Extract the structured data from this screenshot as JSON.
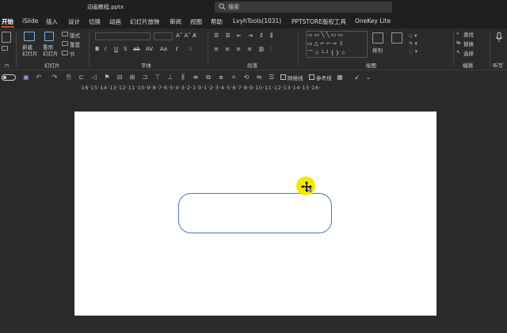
{
  "window": {
    "doc_title": "动画教程.pptx"
  },
  "search": {
    "label": "搜索"
  },
  "tabs": [
    {
      "label": "开始",
      "active": true
    },
    {
      "label": "iSlide"
    },
    {
      "label": "插入"
    },
    {
      "label": "设计"
    },
    {
      "label": "切换"
    },
    {
      "label": "动画"
    },
    {
      "label": "幻灯片放映"
    },
    {
      "label": "审阅"
    },
    {
      "label": "视图"
    },
    {
      "label": "帮助"
    },
    {
      "label": "LvyhTools(1031)"
    },
    {
      "label": "PPTSTORE版权工具"
    },
    {
      "label": "OneKey Lite"
    }
  ],
  "ribbon": {
    "clipboard": {
      "label": "⊓"
    },
    "slides": {
      "label": "幻灯片",
      "new_slide": "新建\n幻灯片",
      "reuse": "重用\n幻灯片",
      "layout": "版式",
      "reset": "重置",
      "section": "节"
    },
    "font": {
      "label": "字体"
    },
    "paragraph": {
      "label": "段落"
    },
    "drawing": {
      "label": "绘图",
      "arrange": "排列"
    },
    "editing": {
      "label": "编辑",
      "find": "查找",
      "replace": "替换",
      "select": "选择"
    },
    "voice": {
      "label": "听写"
    }
  },
  "qat": {
    "gridlines": "网格线",
    "guides": "参考线"
  },
  "ruler": {
    "text": "·16·15·14·13·12·11·10·9·8·7·6·5·4·3·2·1·0·1·2·3·4·5·6·7·8·9·10·11·12·13·14·15·16·"
  },
  "colors": {
    "accent": "#d04a2a",
    "shape_border": "#4a74c9",
    "cursor_highlight": "#f4e800"
  }
}
